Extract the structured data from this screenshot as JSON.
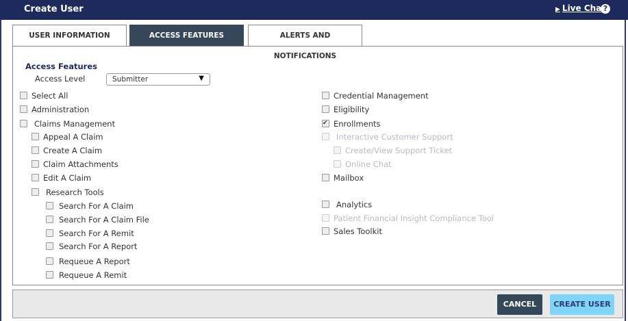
{
  "header": {
    "title": "Create User",
    "live_chat": "Live Chat",
    "help_glyph": "?"
  },
  "tabs": [
    {
      "label": "USER INFORMATION",
      "active": false
    },
    {
      "label": "ACCESS FEATURES",
      "active": true
    },
    {
      "label": "ALERTS AND NOTIFICATIONS",
      "active": false
    }
  ],
  "access": {
    "section_title": "Access Features",
    "level_label": "Access Level",
    "level_value": "Submitter"
  },
  "left_items": [
    {
      "label": "Select All",
      "checked": false,
      "disabled": false
    },
    {
      "label": "Administration",
      "checked": false,
      "disabled": false
    },
    {
      "label": "Claims Management",
      "checked": false,
      "disabled": false
    },
    {
      "label": "Appeal A Claim",
      "checked": false,
      "disabled": false
    },
    {
      "label": "Create A Claim",
      "checked": false,
      "disabled": false
    },
    {
      "label": "Claim Attachments",
      "checked": false,
      "disabled": false
    },
    {
      "label": "Edit A Claim",
      "checked": false,
      "disabled": false
    },
    {
      "label": "Research Tools",
      "checked": false,
      "disabled": false
    },
    {
      "label": "Search For A Claim",
      "checked": false,
      "disabled": false
    },
    {
      "label": "Search For A Claim File",
      "checked": false,
      "disabled": false
    },
    {
      "label": "Search For A Remit",
      "checked": false,
      "disabled": false
    },
    {
      "label": "Search For A Report",
      "checked": false,
      "disabled": false
    },
    {
      "label": "Requeue A Report",
      "checked": false,
      "disabled": false
    },
    {
      "label": "Requeue A Remit",
      "checked": false,
      "disabled": false
    }
  ],
  "right_items": [
    {
      "label": "Credential Management",
      "checked": false,
      "disabled": false
    },
    {
      "label": "Eligibility",
      "checked": false,
      "disabled": false
    },
    {
      "label": "Enrollments",
      "checked": true,
      "disabled": false
    },
    {
      "label": "Interactive Customer Support",
      "checked": false,
      "disabled": true
    },
    {
      "label": "Create/View Support Ticket",
      "checked": false,
      "disabled": true
    },
    {
      "label": "Online Chat",
      "checked": false,
      "disabled": true
    },
    {
      "label": "Mailbox",
      "checked": false,
      "disabled": false
    },
    {
      "label": "Analytics",
      "checked": false,
      "disabled": false
    },
    {
      "label": "Patient Financial Insight Compliance Tool",
      "checked": false,
      "disabled": true
    },
    {
      "label": "Sales Toolkit",
      "checked": false,
      "disabled": false
    }
  ],
  "footer": {
    "cancel": "CANCEL",
    "create": "CREATE USER"
  }
}
